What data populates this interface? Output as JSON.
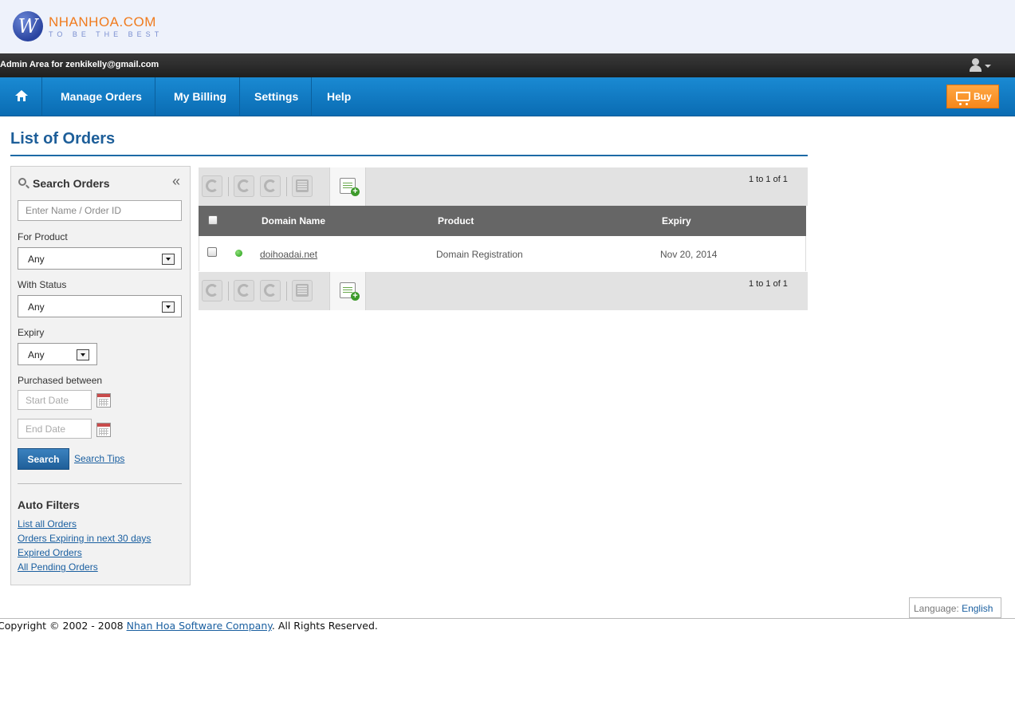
{
  "brand": {
    "logo_letter": "W",
    "name": "NHANHOA.COM",
    "tagline": "TO BE THE BEST",
    "colors": {
      "name": "#f07b1e",
      "tagline": "#7a8fd0",
      "nav": "#0a6cb3",
      "accent_buy": "#f5871b"
    }
  },
  "admin_bar": {
    "text": "Admin Area for zenkikelly@gmail.com",
    "user_icon": "user-icon"
  },
  "nav": {
    "home_icon": "home-icon",
    "items": [
      {
        "label": "Manage Orders"
      },
      {
        "label": "My Billing"
      },
      {
        "label": "Settings"
      },
      {
        "label": "Help"
      }
    ],
    "buy_label": "Buy",
    "buy_icon": "cart-icon"
  },
  "page": {
    "title": "List of Orders"
  },
  "sidebar": {
    "title": "Search Orders",
    "collapse_glyph": "«",
    "name_placeholder": "Enter Name / Order ID",
    "product_label": "For Product",
    "product_value": "Any",
    "status_label": "With Status",
    "status_value": "Any",
    "expiry_label": "Expiry",
    "expiry_value": "Any",
    "purchased_label": "Purchased between",
    "start_placeholder": "Start Date",
    "end_placeholder": "End Date",
    "search_button": "Search",
    "search_tips": "Search Tips",
    "auto_filters_title": "Auto Filters",
    "auto_filters": [
      "List all Orders",
      "Orders Expiring in next 30 days",
      "Expired Orders",
      "All Pending Orders"
    ]
  },
  "orders": {
    "pager_top": "1 to 1 of 1",
    "pager_bottom": "1 to 1 of 1",
    "toolbar_icons": [
      "refresh-icon",
      "suspend-icon",
      "unsuspend-icon",
      "edit-list-icon",
      "add-order-icon"
    ],
    "columns": {
      "domain": "Domain Name",
      "product": "Product",
      "expiry": "Expiry"
    },
    "rows": [
      {
        "domain": "doihoadai.net",
        "product": "Domain Registration",
        "expiry": "Nov 20, 2014",
        "status_color": "#1f9a12"
      }
    ]
  },
  "footer": {
    "language_label": "Language:",
    "language_value": "English",
    "copyright_prefix": "Copyright © 2002 - 2008 ",
    "company": "Nhan Hoa Software Company",
    "copyright_suffix": ". All Rights Reserved."
  }
}
